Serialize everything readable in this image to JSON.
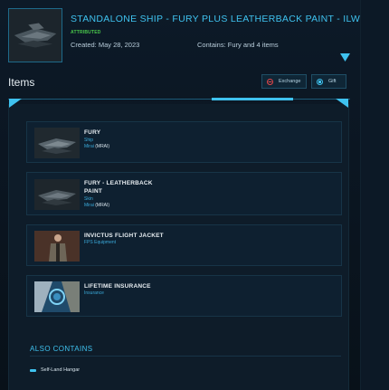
{
  "header": {
    "title": "STANDALONE SHIP - FURY PLUS LEATHERBACK PAINT - ILW",
    "status_badge": "ATTRIBUTED",
    "created": "Created: May 28, 2023",
    "contains": "Contains: Fury and 4 items",
    "expand_icon": "chevron-down-icon"
  },
  "items_section": {
    "title": "Items",
    "exchange_label": "Exchange",
    "gift_label": "Gift"
  },
  "items": [
    {
      "name": "FURY",
      "type": "Ship",
      "maker": "Mirai",
      "maker_code": "(MRAI)",
      "icon": "ship-thumbnail"
    },
    {
      "name": "FURY - LEATHERBACK PAINT",
      "type": "Skin",
      "maker": "Mirai",
      "maker_code": "(MRAI)",
      "icon": "paint-thumbnail"
    },
    {
      "name": "INVICTUS FLIGHT JACKET",
      "type": "FPS Equipment",
      "icon": "jacket-thumbnail"
    },
    {
      "name": "LIFETIME INSURANCE",
      "type": "Insurance",
      "icon": "insurance-thumbnail"
    }
  ],
  "also_contains": {
    "title": "ALSO CONTAINS",
    "items": [
      "Self-Land Hangar"
    ]
  },
  "colors": {
    "accent": "#3fc2ef",
    "badge": "#49c74b",
    "background": "#0a1420"
  }
}
